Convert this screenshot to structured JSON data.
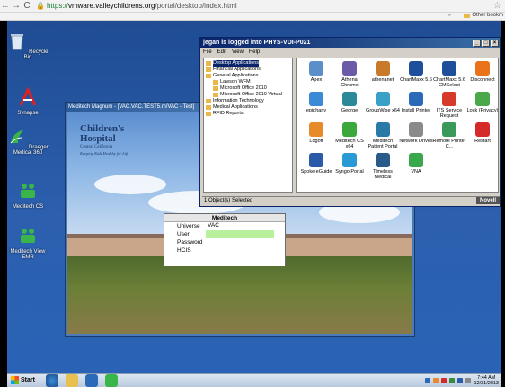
{
  "browser": {
    "url_scheme": "https://",
    "url_host": "vmware.valleychildrens.org",
    "url_path": "/portal/desktop/index.html",
    "bookmarks_more": "»",
    "other_bookmarks": "Other bookm"
  },
  "desktop_icons": [
    {
      "label": "Recycle Bin",
      "icon": "recycle-bin-icon"
    },
    {
      "label": "Synapse",
      "icon": "synapse-icon"
    },
    {
      "label": "Draeger Medical 360",
      "icon": "draeger-icon"
    },
    {
      "label": "Meditech CS",
      "icon": "meditech-icon"
    },
    {
      "label": "Meditech View EMR",
      "icon": "meditech-view-icon"
    }
  ],
  "citrix_window": {
    "title": "jegan is logged into PHYS-VDI-P021",
    "menu": [
      "File",
      "Edit",
      "View",
      "Help"
    ],
    "tree": [
      {
        "label": "Desktop Applications",
        "selected": true,
        "indent": 0
      },
      {
        "label": "Financial Applications",
        "selected": false,
        "indent": 0
      },
      {
        "label": "General Applications",
        "selected": false,
        "indent": 0
      },
      {
        "label": "Lawson WFM",
        "selected": false,
        "indent": 1
      },
      {
        "label": "Microsoft Office 2010",
        "selected": false,
        "indent": 1
      },
      {
        "label": "Microsoft Office 2010 Virtual",
        "selected": false,
        "indent": 1
      },
      {
        "label": "Information Technology",
        "selected": false,
        "indent": 0
      },
      {
        "label": "Medical Applications",
        "selected": false,
        "indent": 0
      },
      {
        "label": "RFID Reports",
        "selected": false,
        "indent": 0
      }
    ],
    "apps": [
      {
        "label": "Apex",
        "color": "#5b8fc9"
      },
      {
        "label": "Athena Chrome",
        "color": "#6a5aa8"
      },
      {
        "label": "athenanet",
        "color": "#c87a2a"
      },
      {
        "label": "ChartMaxx 5.6",
        "color": "#1d4f9a"
      },
      {
        "label": "ChartMaxx 5.6 CMSelect",
        "color": "#1d4f9a"
      },
      {
        "label": "Disconnect",
        "color": "#e8731a"
      },
      {
        "label": "epiphany",
        "color": "#3a8ad6"
      },
      {
        "label": "George",
        "color": "#2a8a9a"
      },
      {
        "label": "GroupWise x64",
        "color": "#3aa0c8"
      },
      {
        "label": "Install Printer",
        "color": "#2a6ab8"
      },
      {
        "label": "ITS Service Request",
        "color": "#d63a2a"
      },
      {
        "label": "Lock (Privacy)",
        "color": "#4aa84a"
      },
      {
        "label": "Logoff",
        "color": "#e88a2a"
      },
      {
        "label": "Meditech CS x64",
        "color": "#3aa83a"
      },
      {
        "label": "Meditech Patient Portal",
        "color": "#2a7aa8"
      },
      {
        "label": "Network Drives",
        "color": "#8a8a8a"
      },
      {
        "label": "Remote Printer C...",
        "color": "#3a9a5a"
      },
      {
        "label": "Restart",
        "color": "#d62a2a"
      },
      {
        "label": "Spoke eGuide",
        "color": "#2a5aa8"
      },
      {
        "label": "Syngo Portal",
        "color": "#2a9ad6"
      },
      {
        "label": "Timeless Medical",
        "color": "#2a5a8a"
      },
      {
        "label": "VNA",
        "color": "#3aa84a"
      }
    ],
    "status_text": "1 Object(s) Selected",
    "brand": "Novell"
  },
  "meditech_window": {
    "title": "Meditech Magnum - [VAC.VAC.TEST5.m/VAC - Test]",
    "logo_line1": "Children's",
    "logo_line2": "Hospital",
    "logo_line3": "Central California",
    "logo_tagline": "Keeping Kids Healthy for Life"
  },
  "login_dialog": {
    "title": "Meditech",
    "fields": [
      {
        "label": "Universe",
        "value": "VAC",
        "highlight": false
      },
      {
        "label": "User",
        "value": "",
        "highlight": true
      },
      {
        "label": "Password",
        "value": "",
        "highlight": false
      },
      {
        "label": "HCIS",
        "value": "",
        "highlight": false
      }
    ]
  },
  "taskbar": {
    "start_label": "Start",
    "time": "7:44 AM",
    "date": "12/31/2013"
  }
}
